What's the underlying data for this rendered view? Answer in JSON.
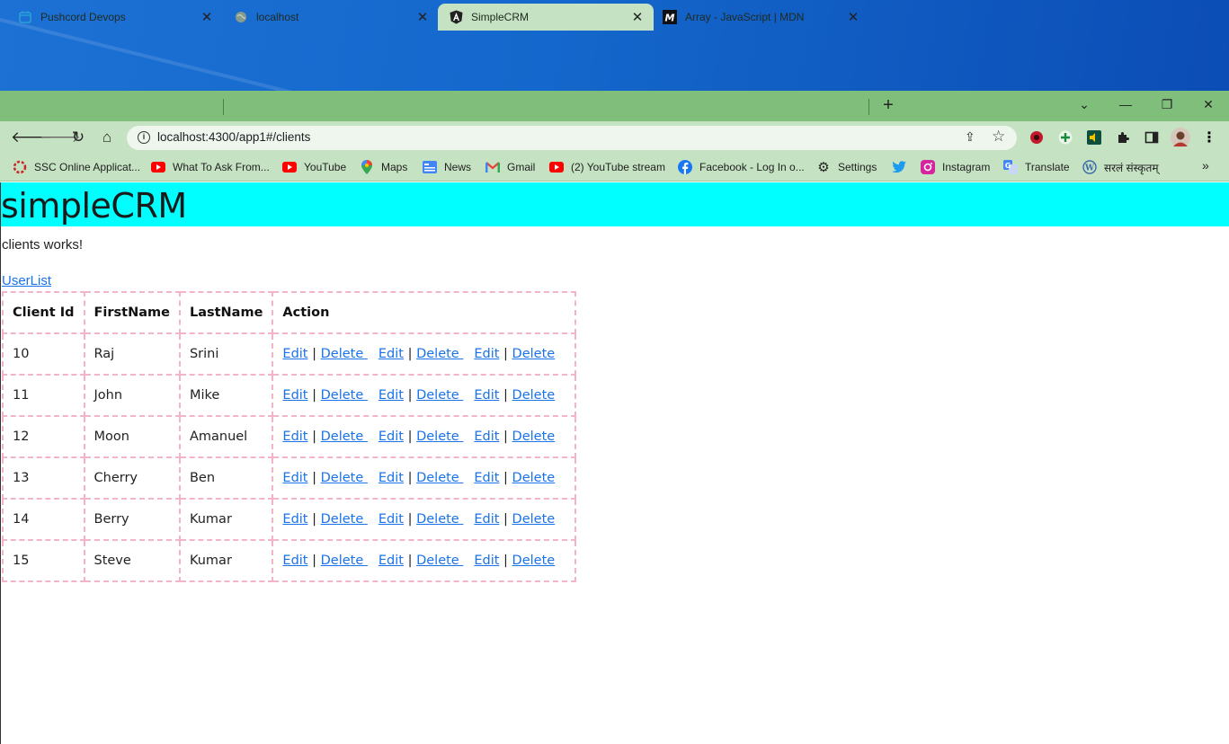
{
  "browser": {
    "tabs": [
      {
        "title": "Pushcord Devops",
        "favicon": "calendar-icon",
        "active": false
      },
      {
        "title": "localhost",
        "favicon": "globe-icon",
        "active": false
      },
      {
        "title": "SimpleCRM",
        "favicon": "angular-icon",
        "active": true
      },
      {
        "title": "Array - JavaScript | MDN",
        "favicon": "mdn-icon",
        "active": false
      }
    ],
    "new_tab_label": "+",
    "url": "localhost:4300/app1#/clients",
    "bookmarks": [
      {
        "label": "SSC Online Applicat...",
        "icon": "ssc-icon"
      },
      {
        "label": "What To Ask From...",
        "icon": "youtube-icon"
      },
      {
        "label": "YouTube",
        "icon": "youtube-icon"
      },
      {
        "label": "Maps",
        "icon": "maps-icon"
      },
      {
        "label": "News",
        "icon": "news-icon"
      },
      {
        "label": "Gmail",
        "icon": "gmail-icon"
      },
      {
        "label": "(2) YouTube stream",
        "icon": "youtube-icon"
      },
      {
        "label": "Facebook - Log In o...",
        "icon": "facebook-icon"
      },
      {
        "label": "Settings",
        "icon": "gear-icon"
      },
      {
        "label": "",
        "icon": "twitter-icon"
      },
      {
        "label": "Instagram",
        "icon": "instagram-icon"
      },
      {
        "label": "Translate",
        "icon": "translate-icon"
      },
      {
        "label": "सरलं संस्कृतम्",
        "icon": "wordpress-icon"
      }
    ],
    "colors": {
      "frame": "#7fbf7b",
      "toolbar": "#c5e2c2",
      "app_header": "#00ffff",
      "link": "#1a73e8",
      "table_border": "#f3b3c8"
    }
  },
  "app": {
    "title": "simpleCRM",
    "status_text": "clients works!",
    "userlist_link": "UserList",
    "table": {
      "headers": {
        "id": "Client Id",
        "first": "FirstName",
        "last": "LastName",
        "action": "Action"
      },
      "edit_label": "Edit",
      "delete_label": "Delete ",
      "separator": "|",
      "rows": [
        {
          "id": "10",
          "first": "Raj",
          "last": "Srini"
        },
        {
          "id": "11",
          "first": "John",
          "last": "Mike"
        },
        {
          "id": "12",
          "first": "Moon",
          "last": "Amanuel"
        },
        {
          "id": "13",
          "first": "Cherry",
          "last": "Ben"
        },
        {
          "id": "14",
          "first": "Berry",
          "last": "Kumar"
        },
        {
          "id": "15",
          "first": "Steve",
          "last": "Kumar"
        }
      ]
    }
  }
}
